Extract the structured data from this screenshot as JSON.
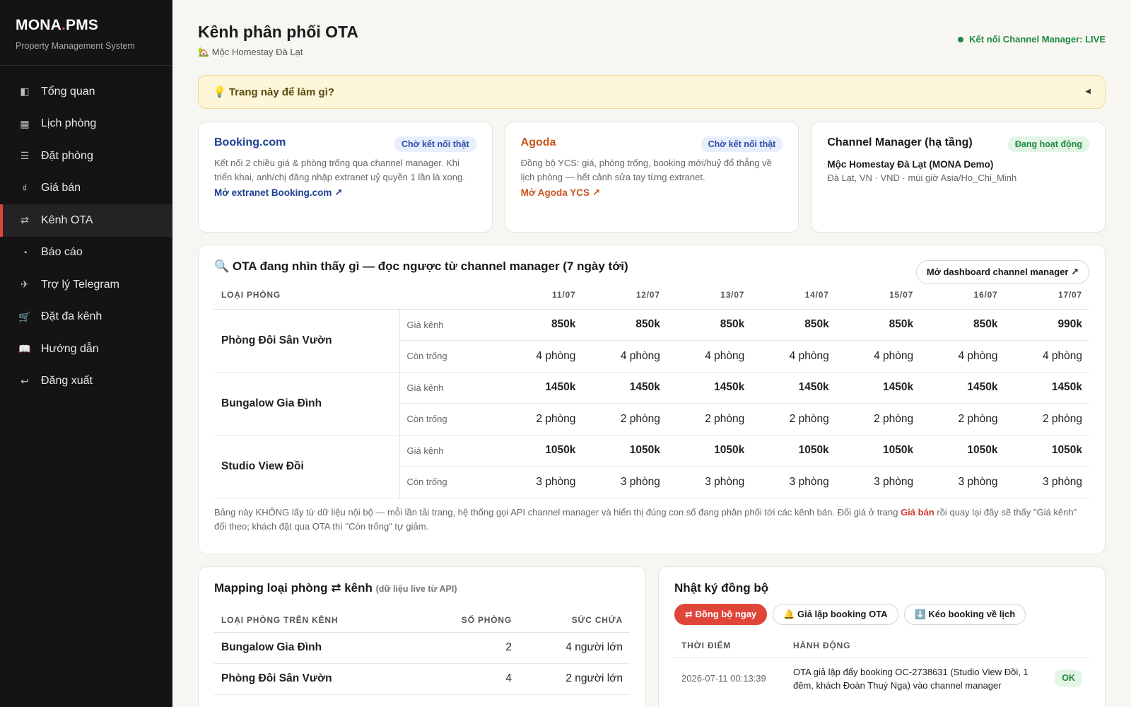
{
  "brand": {
    "name_a": "MONA",
    "name_dot": ".",
    "name_b": "PMS",
    "subtitle": "Property Management System"
  },
  "nav": [
    {
      "icon": "◧",
      "icon_name": "dashboard-icon",
      "label": "Tổng quan"
    },
    {
      "icon": "▦",
      "icon_name": "calendar-icon",
      "label": "Lịch phòng"
    },
    {
      "icon": "☰",
      "icon_name": "list-icon",
      "label": "Đặt phòng"
    },
    {
      "icon": "₫",
      "icon_name": "price-icon",
      "label": "Giá bán"
    },
    {
      "icon": "⇄",
      "icon_name": "swap-icon",
      "label": "Kênh OTA"
    },
    {
      "icon": "◔",
      "icon_name": "report-icon",
      "label": "Báo cáo"
    },
    {
      "icon": "✈",
      "icon_name": "telegram-icon",
      "label": "Trợ lý Telegram"
    },
    {
      "icon": "🛒",
      "icon_name": "cart-icon",
      "label": "Đặt đa kênh"
    },
    {
      "icon": "📖",
      "icon_name": "book-icon",
      "label": "Hướng dẫn"
    },
    {
      "icon": "↩",
      "icon_name": "logout-icon",
      "label": "Đăng xuất"
    }
  ],
  "active_nav": 4,
  "page": {
    "title": "Kênh phân phối OTA",
    "property": "🏡 Mộc Homestay Đà Lạt",
    "cm_status": "Kết nối Channel Manager: LIVE"
  },
  "help": {
    "label": "💡 Trang này để làm gì?",
    "caret": "◀"
  },
  "cards": {
    "booking": {
      "name": "Booking.com",
      "badge": "Chờ kết nối thật",
      "desc": "Kết nối 2 chiều giá & phòng trống qua channel manager. Khi triển khai, anh/chị đăng nhập extranet uỷ quyền 1 lần là xong.",
      "link": "Mở extranet Booking.com ↗"
    },
    "agoda": {
      "name": "Agoda",
      "badge": "Chờ kết nối thật",
      "desc": "Đồng bộ YCS: giá, phòng trống, booking mới/huỷ đổ thẳng về lịch phòng — hết cảnh sửa tay từng extranet.",
      "link": "Mở Agoda YCS ↗"
    },
    "cm": {
      "name": "Channel Manager (hạ tầng)",
      "badge": "Đang hoạt động",
      "property": "Mộc Homestay Đà Lạt (MONA Demo)",
      "location": "Đà Lạt, VN · VND · múi giờ Asia/Ho_Chi_Minh"
    }
  },
  "ota": {
    "title": "🔍 OTA đang nhìn thấy gì — đọc ngược từ channel manager (7 ngày tới)",
    "button": "Mở dashboard channel manager ↗",
    "col_room": "LOẠI PHÒNG",
    "dates": [
      "11/07",
      "12/07",
      "13/07",
      "14/07",
      "15/07",
      "16/07",
      "17/07"
    ],
    "price_label": "Giá kênh",
    "avail_label": "Còn trống",
    "rooms": [
      {
        "name": "Phòng Đôi Sân Vườn",
        "prices": [
          "850k",
          "850k",
          "850k",
          "850k",
          "850k",
          "850k",
          "990k"
        ],
        "avail": [
          "4 phòng",
          "4 phòng",
          "4 phòng",
          "4 phòng",
          "4 phòng",
          "4 phòng",
          "4 phòng"
        ]
      },
      {
        "name": "Bungalow Gia Đình",
        "prices": [
          "1450k",
          "1450k",
          "1450k",
          "1450k",
          "1450k",
          "1450k",
          "1450k"
        ],
        "avail": [
          "2 phòng",
          "2 phòng",
          "2 phòng",
          "2 phòng",
          "2 phòng",
          "2 phòng",
          "2 phòng"
        ]
      },
      {
        "name": "Studio View Đồi",
        "prices": [
          "1050k",
          "1050k",
          "1050k",
          "1050k",
          "1050k",
          "1050k",
          "1050k"
        ],
        "avail": [
          "3 phòng",
          "3 phòng",
          "3 phòng",
          "3 phòng",
          "3 phòng",
          "3 phòng",
          "3 phòng"
        ]
      }
    ],
    "note_a": "Bảng này KHÔNG lấy từ dữ liệu nội bộ — mỗi lần tải trang, hệ thống gọi API channel manager và hiển thị đúng con số đang phân phối tới các kênh bán. Đổi giá ở trang ",
    "note_link": "Giá bán",
    "note_b": " rồi quay lại đây sẽ thấy \"Giá kênh\" đổi theo; khách đặt qua OTA thì \"Còn trống\" tự giảm."
  },
  "mapping": {
    "title": "Mapping loại phòng ⇄ kênh",
    "subtitle": "(dữ liệu live từ API)",
    "headers": [
      "LOẠI PHÒNG TRÊN KÊNH",
      "SỐ PHÒNG",
      "SỨC CHỨA"
    ],
    "rows": [
      {
        "name": "Bungalow Gia Đình",
        "count": "2",
        "capacity": "4 người lớn"
      },
      {
        "name": "Phòng Đôi Sân Vườn",
        "count": "4",
        "capacity": "2 người lớn"
      }
    ]
  },
  "log": {
    "title": "Nhật ký đồng bộ",
    "btn_sync": "⇄ Đồng bộ ngay",
    "btn_sim": "🔔 Giả lập booking OTA",
    "btn_pull": "⬇️ Kéo booking về lịch",
    "headers": [
      "THỜI ĐIỂM",
      "HÀNH ĐỘNG"
    ],
    "rows": [
      {
        "time": "2026-07-11 00:13:39",
        "action": "OTA giả lập đẩy booking OC-2738631 (Studio View Đồi, 1 đêm, khách Đoàn Thuý Nga) vào channel manager",
        "status": "OK"
      }
    ]
  }
}
